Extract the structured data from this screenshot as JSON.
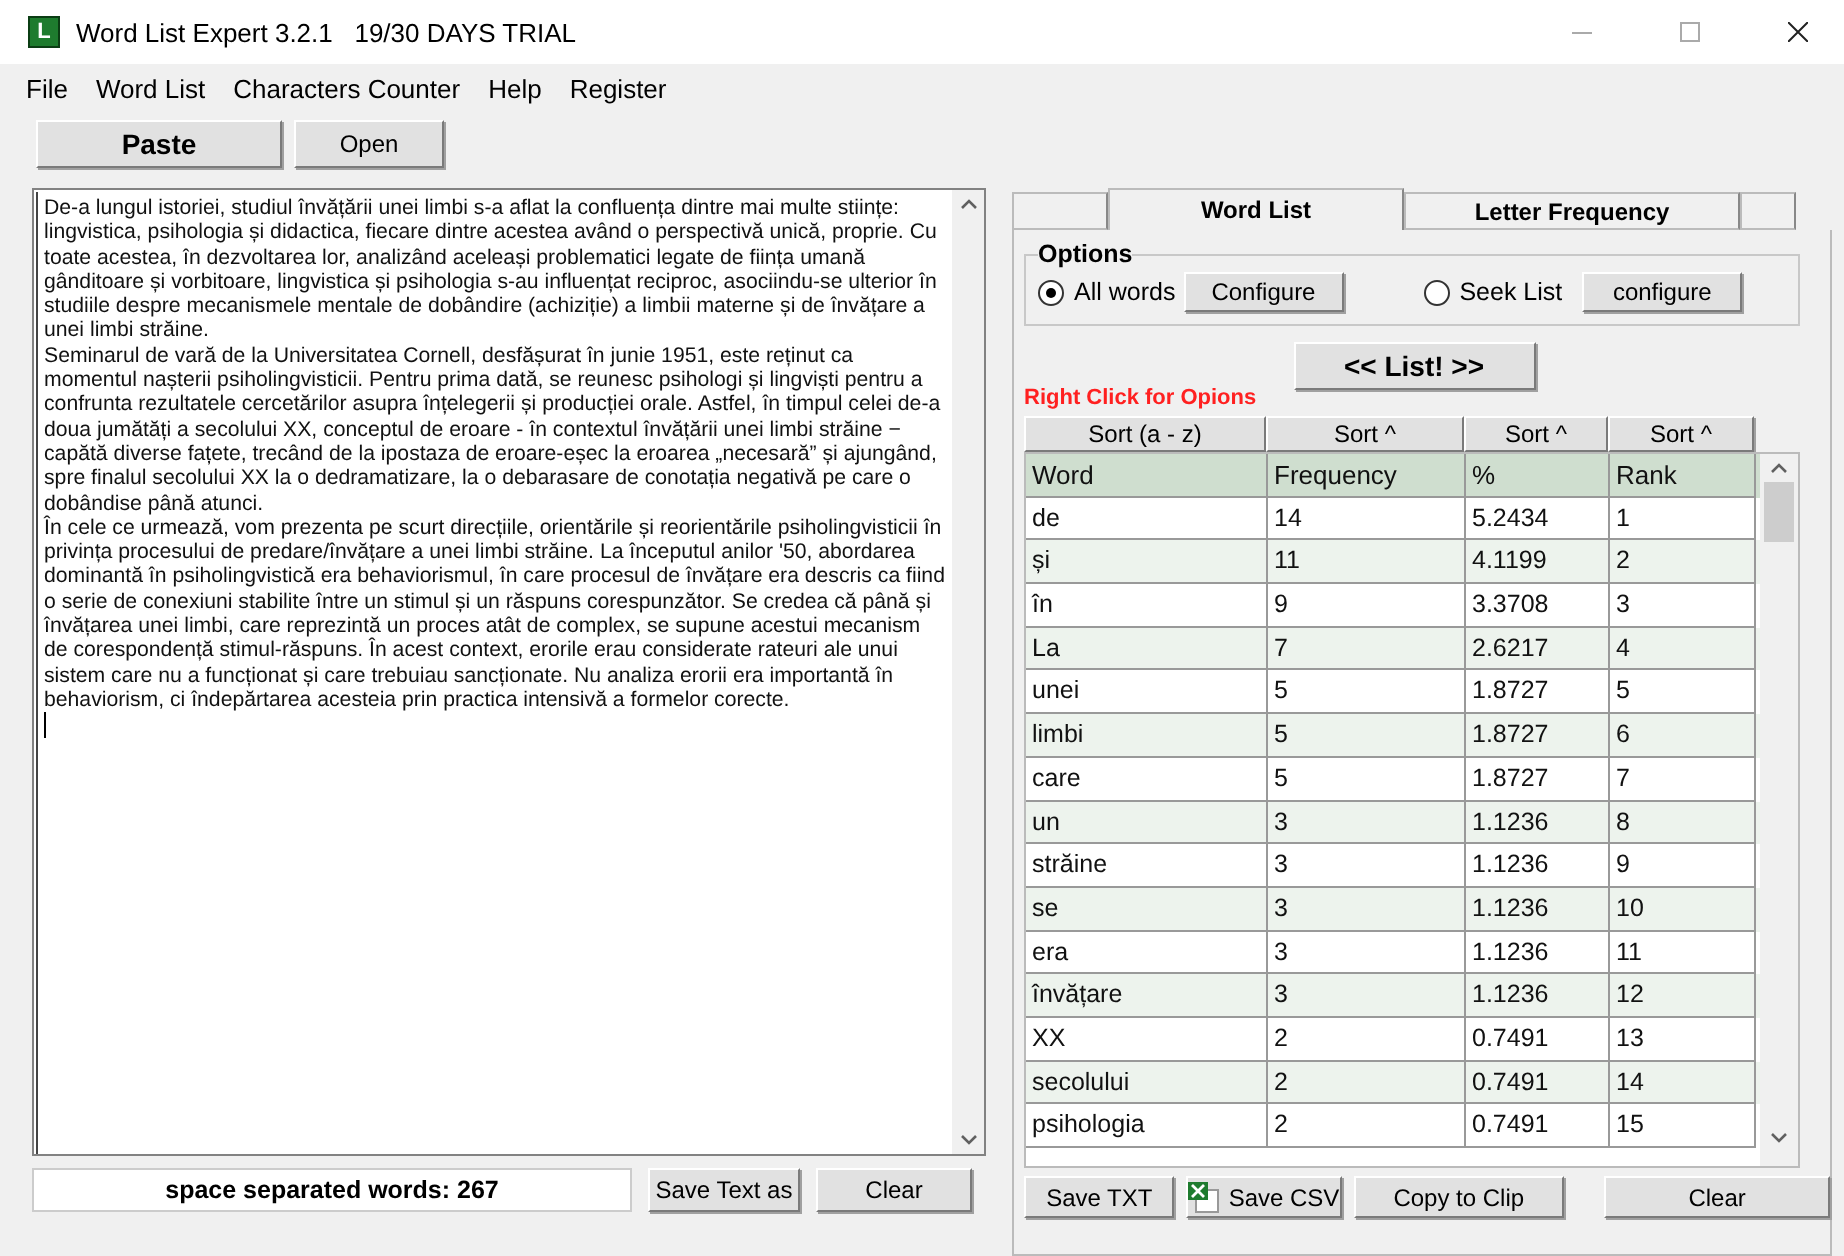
{
  "window": {
    "app_icon_letter": "L",
    "title": "Word List Expert 3.2.1   19/30 DAYS TRIAL"
  },
  "menu": [
    "File",
    "Word List",
    "Characters Counter",
    "Help",
    "Register"
  ],
  "toolbar": [
    {
      "label": "Paste",
      "kind": "primary"
    },
    {
      "label": "Open",
      "kind": "normal"
    }
  ],
  "editor": {
    "paragraphs": [
      "De-a lungul istoriei, studiul învățării unei limbi s-a aflat la confluența dintre mai multe stiințe: lingvistica, psihologia și didactica, fiecare dintre acestea având o perspectivă unică, proprie. Cu toate acestea, în dezvoltarea lor, analizând aceleași problematici legate de ființa umană gânditoare și vorbitoare, lingvistica și psihologia s-au influențat reciproc, asociindu-se ulterior în studiile despre  mecanismele mentale de dobândire (achiziție) a limbii materne și de învățare a unei limbi străine.",
      "Seminarul de vară de la Universitatea Cornell, desfășurat în junie 1951, este reținut ca momentul nașterii psiholingvisticii. Pentru prima dată, se reunesc psihologi și lingviști pentru a confrunta rezultatele cercetărilor asupra înțelegerii și producției orale. Astfel, în timpul celei de-a doua jumătăți a secolului XX, conceptul de eroare - în contextul învățării unei limbi străine − capătă diverse fațete, trecând de la ipostaza de eroare-eșec la eroarea „necesară” și ajungând, spre finalul secolului XX la o dedramatizare, la o debarasare de conotația negativă pe care o dobândise până atunci.",
      "În cele ce urmează, vom prezenta pe scurt direcțiile, orientările și reorientările psiholingvisticii în privința procesului de predare/învățare a unei limbi străine. La începutul anilor '50, abordarea dominantă în psiholingvistică era behaviorismul, în care procesul de învățare era descris ca fiind o serie de conexiuni stabilite între un stimul și un răspuns corespunzător. Se credea că până și învățarea unei limbi, care reprezintă un proces atât de complex, se supune acestui mecanism de corespondență stimul-răspuns. În acest context, erorile erau considerate rateuri ale unui sistem care nu a funcționat și care trebuiau sancționate. Nu analiza erorii era importantă în behaviorism, ci îndepărtarea acesteia prin practica intensivă a formelor corecte."
    ]
  },
  "word_count": "space separated words: 267",
  "editor_buttons": [
    "Save Text as",
    "Clear"
  ],
  "tabs": [
    {
      "label": "Word List",
      "selected": true
    },
    {
      "label": "Letter Frequency",
      "selected": false
    }
  ],
  "options": {
    "title": "Options",
    "choices": [
      {
        "label": "All words",
        "selected": true,
        "button": "Configure"
      },
      {
        "label": "Seek List",
        "selected": false,
        "button": "configure"
      }
    ]
  },
  "list_button": "<< List! >>",
  "hint": "Right Click for Opions",
  "sort_buttons": [
    "Sort (a - z)",
    "Sort ^",
    "Sort ^",
    "Sort ^"
  ],
  "table": {
    "columns": [
      "Word",
      "Frequency",
      "%",
      "Rank"
    ],
    "rows": [
      [
        "de",
        "14",
        "5.2434",
        "1"
      ],
      [
        "și",
        "11",
        "4.1199",
        "2"
      ],
      [
        "în",
        "9",
        "3.3708",
        "3"
      ],
      [
        "La",
        "7",
        "2.6217",
        "4"
      ],
      [
        "unei",
        "5",
        "1.8727",
        "5"
      ],
      [
        "limbi",
        "5",
        "1.8727",
        "6"
      ],
      [
        "care",
        "5",
        "1.8727",
        "7"
      ],
      [
        "un",
        "3",
        "1.1236",
        "8"
      ],
      [
        "străine",
        "3",
        "1.1236",
        "9"
      ],
      [
        "se",
        "3",
        "1.1236",
        "10"
      ],
      [
        "era",
        "3",
        "1.1236",
        "11"
      ],
      [
        "învățare",
        "3",
        "1.1236",
        "12"
      ],
      [
        "XX",
        "2",
        "0.7491",
        "13"
      ],
      [
        "secolului",
        "2",
        "0.7491",
        "14"
      ],
      [
        "psihologia",
        "2",
        "0.7491",
        "15"
      ]
    ]
  },
  "bottom_buttons": [
    {
      "label": "Save TXT",
      "kind": "plain"
    },
    {
      "label": "Save CSV",
      "kind": "excel"
    },
    {
      "label": "Copy to Clip",
      "kind": "plain"
    },
    {
      "label": "Clear",
      "kind": "plain"
    }
  ]
}
